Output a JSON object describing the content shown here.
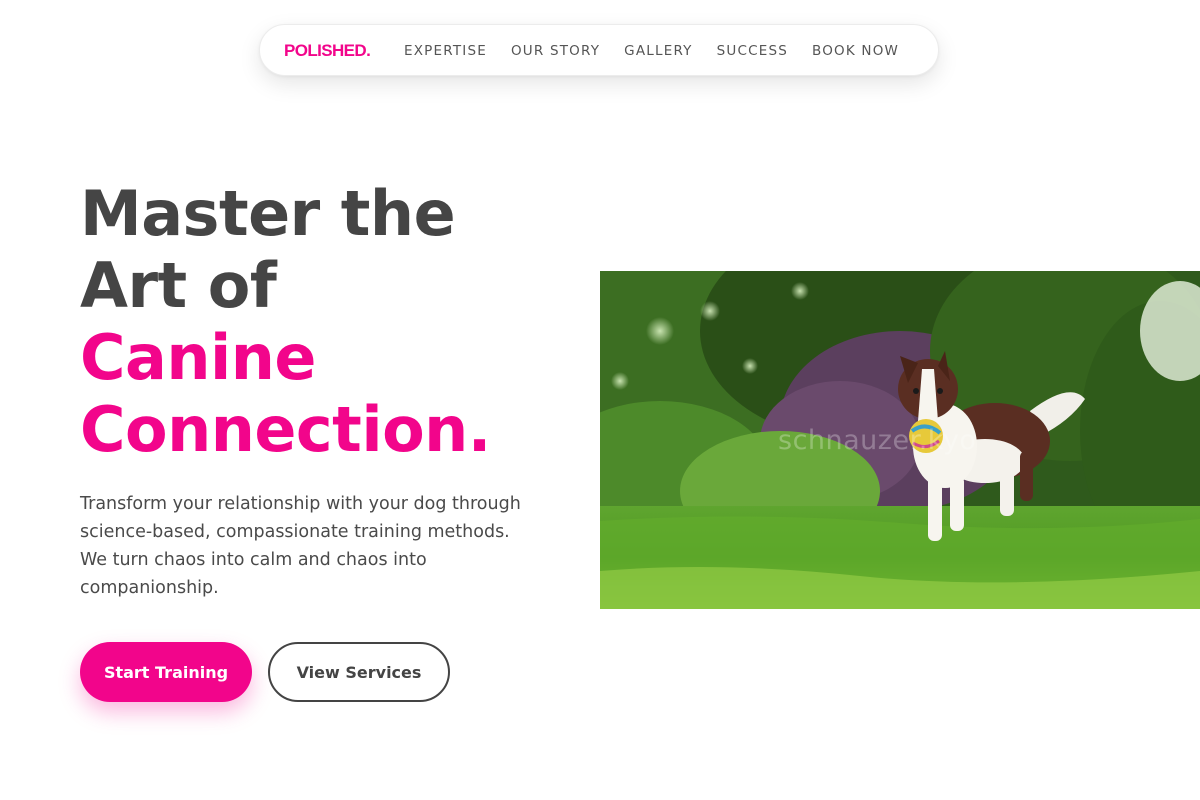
{
  "nav": {
    "brand": "POLISHED.",
    "brand_color": "#f2058b",
    "links": [
      {
        "label": "EXPERTISE"
      },
      {
        "label": "OUR STORY"
      },
      {
        "label": "GALLERY"
      },
      {
        "label": "SUCCESS"
      },
      {
        "label": "BOOK NOW"
      }
    ]
  },
  "hero": {
    "title_line1": "Master the",
    "title_line2": "Art of",
    "title_accent_line1": "Canine",
    "title_accent_line2": "Connection.",
    "description": "Transform your relationship with your dog through science-based, compassionate training methods. We turn chaos into calm and chaos into companionship.",
    "primary_button": "Start Training",
    "secondary_button": "View Services",
    "accent_color": "#f2058b",
    "text_color": "#454545"
  },
  "image": {
    "subject": "border collie running on grass with a ball in its mouth",
    "watermark": "schnauzer.kyo"
  }
}
